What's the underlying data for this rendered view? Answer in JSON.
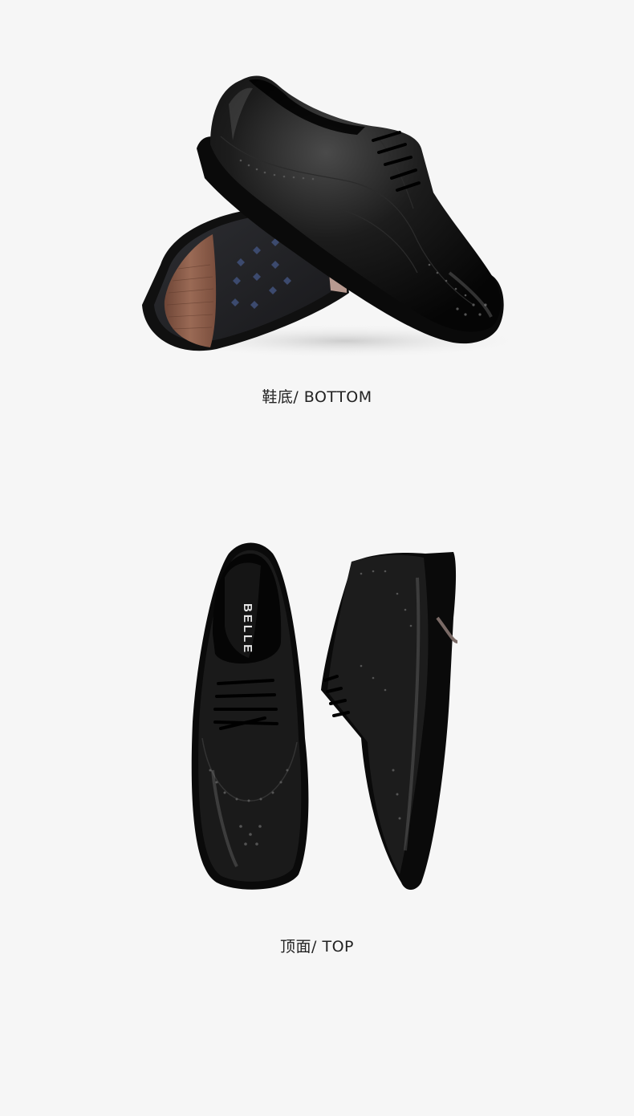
{
  "sections": [
    {
      "caption": "鞋底/ BOTTOM"
    },
    {
      "caption": "顶面/ TOP"
    }
  ],
  "brand_label": "BELLE",
  "colors": {
    "background": "#f6f6f6",
    "leather": "#141414",
    "heel_wood": "#8b5a45",
    "caption_text": "#222222"
  },
  "icons": [
    "brogue-shoe-side-view",
    "shoe-sole-view",
    "brogue-shoe-top-view",
    "brogue-shoe-side-view-top"
  ]
}
